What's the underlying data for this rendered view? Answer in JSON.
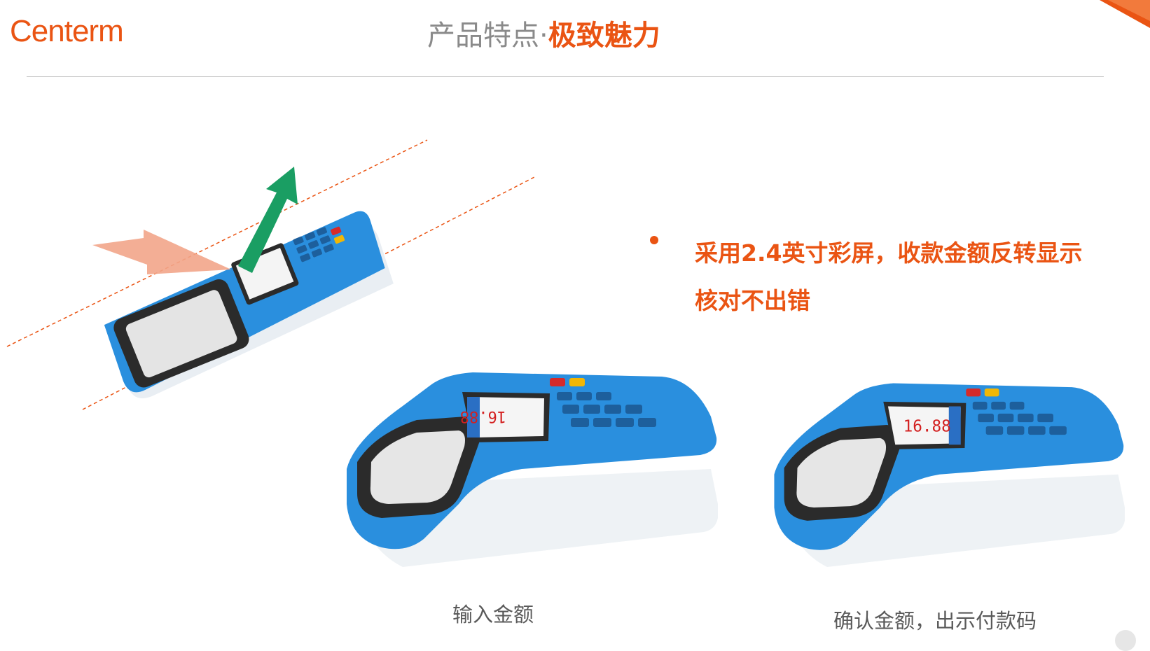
{
  "header": {
    "logo": "Centerm",
    "title_part1": "产品特点·",
    "title_part2": "极致魅力"
  },
  "feature": {
    "bullet_line1": "采用2.4英寸彩屏，收款金额反转显示",
    "bullet_line2": "核对不出错"
  },
  "captions": {
    "input_amount": "输入金额",
    "confirm_amount": "确认金额，出示付款码"
  },
  "screens": {
    "amount": "16.88"
  },
  "colors": {
    "accent": "#ea5413",
    "device_blue": "#2a8fde",
    "arrow_green": "#1a9e63"
  }
}
